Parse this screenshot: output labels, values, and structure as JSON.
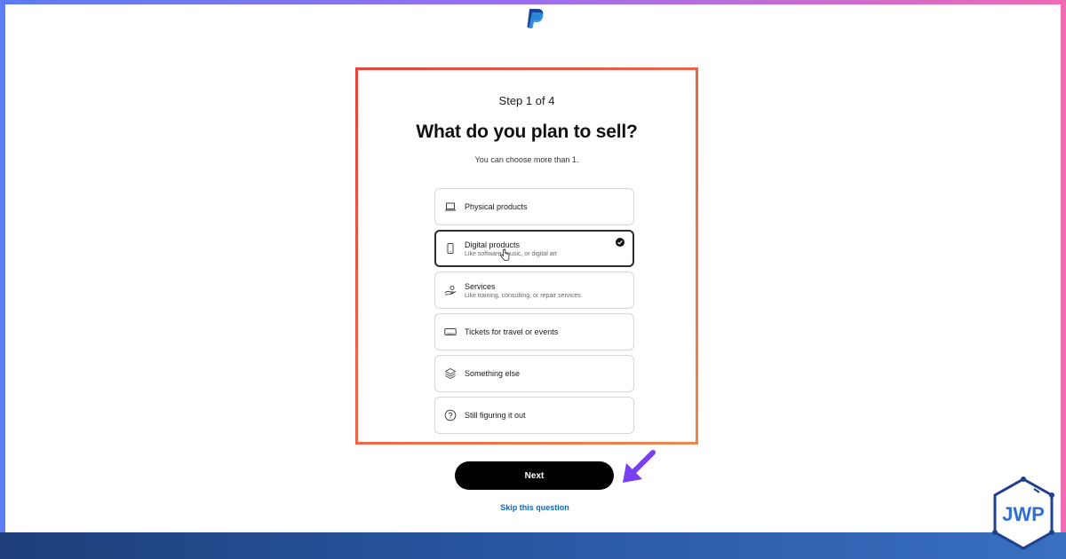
{
  "header": {
    "logo_icon": "paypal-logo-icon"
  },
  "form": {
    "step": "Step 1 of 4",
    "title": "What do you plan to sell?",
    "subtitle": "You can choose more than 1.",
    "options": [
      {
        "label": "Physical products",
        "description": "",
        "icon": "laptop-icon",
        "selected": false
      },
      {
        "label": "Digital products",
        "description": "Like software, music, or digital art",
        "icon": "phone-icon",
        "selected": true
      },
      {
        "label": "Services",
        "description": "Like training, consulting, or repair services",
        "icon": "hand-service-icon",
        "selected": false
      },
      {
        "label": "Tickets for travel or events",
        "description": "",
        "icon": "ticket-icon",
        "selected": false
      },
      {
        "label": "Something else",
        "description": "",
        "icon": "layers-icon",
        "selected": false
      },
      {
        "label": "Still figuring it out",
        "description": "",
        "icon": "question-icon",
        "selected": false
      }
    ],
    "next_label": "Next",
    "skip_label": "Skip this question"
  },
  "branding": {
    "watermark_text": "JWP"
  },
  "colors": {
    "accent_link": "#1565c0",
    "highlight_border": "#e8413b",
    "arrow": "#7b3ff2",
    "button": "#000000"
  }
}
